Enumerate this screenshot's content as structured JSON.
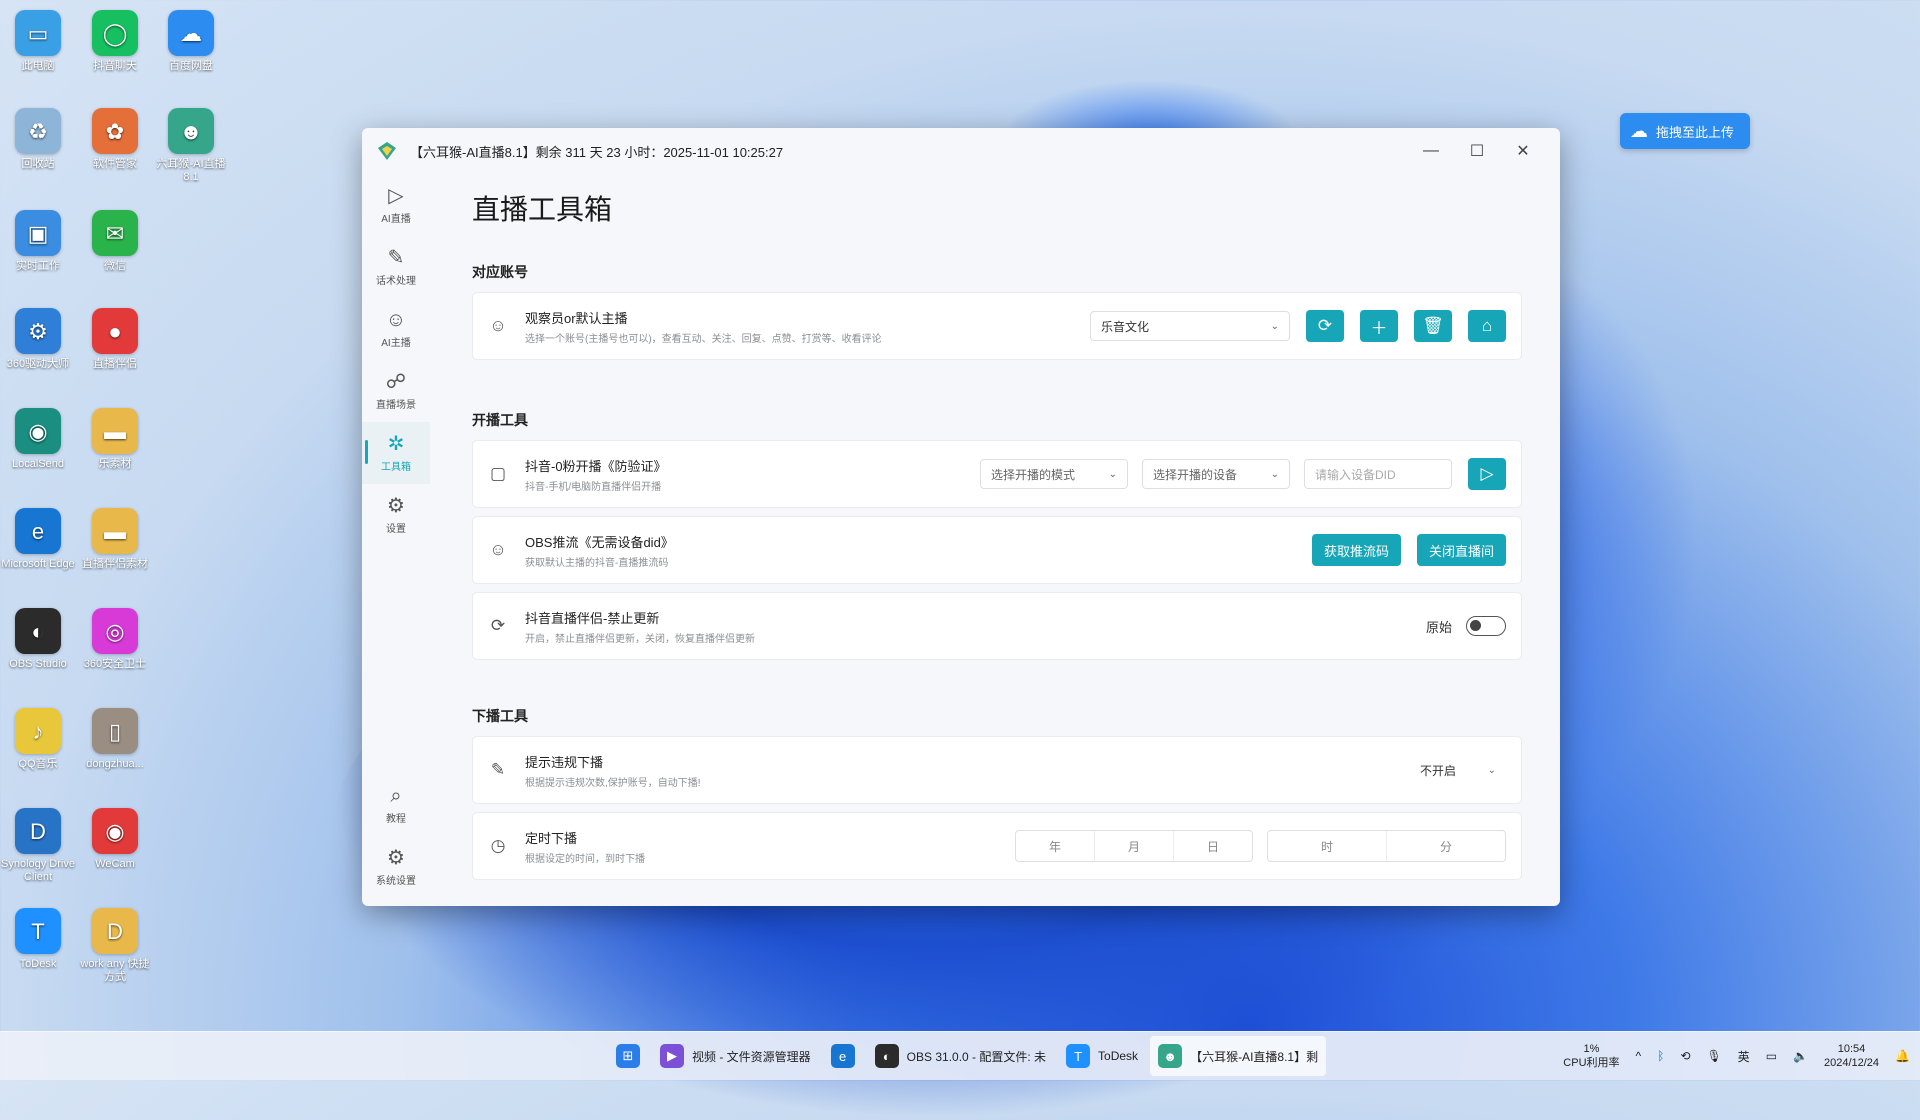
{
  "desktop": {
    "icons": [
      {
        "label": "此电脑",
        "color": "#3aa0e6",
        "glyph": "▭"
      },
      {
        "label": "抖音聊天",
        "color": "#16c060",
        "glyph": "◯"
      },
      {
        "label": "百度网盘",
        "color": "#2d8cf0",
        "glyph": "☁"
      },
      {
        "label": "回收站",
        "color": "#8db5d8",
        "glyph": "♻"
      },
      {
        "label": "软件管家",
        "color": "#e46f39",
        "glyph": "✿"
      },
      {
        "label": "六耳猴-AI直播8.1",
        "color": "#35a68a",
        "glyph": "☻"
      },
      {
        "label": "实时工作",
        "color": "#3a8de0",
        "glyph": "▣"
      },
      {
        "label": "微信",
        "color": "#29b34a",
        "glyph": "✉"
      },
      {
        "label": "360驱动大师",
        "color": "#2f7fd8",
        "glyph": "⚙"
      },
      {
        "label": "直播伴侣",
        "color": "#e23a3a",
        "glyph": "●"
      },
      {
        "label": "LocalSend",
        "color": "#1a8e80",
        "glyph": "◉"
      },
      {
        "label": "乐素材",
        "color": "#e8b94a",
        "glyph": "▬"
      },
      {
        "label": "Microsoft Edge",
        "color": "#1676d2",
        "glyph": "e"
      },
      {
        "label": "直播伴侣素材",
        "color": "#e8b94a",
        "glyph": "▬"
      },
      {
        "label": "OBS Studio",
        "color": "#2b2b2b",
        "glyph": "◐"
      },
      {
        "label": "360安全卫士",
        "color": "#d83ad8",
        "glyph": "◎"
      },
      {
        "label": "QQ音乐",
        "color": "#e8c83a",
        "glyph": "♪"
      },
      {
        "label": "dongzhua...",
        "color": "#9a8d82",
        "glyph": "▯"
      },
      {
        "label": "Synology Drive Client",
        "color": "#2774c6",
        "glyph": "D"
      },
      {
        "label": "WeCam",
        "color": "#e23a3a",
        "glyph": "◉"
      },
      {
        "label": "ToDesk",
        "color": "#1e90ff",
        "glyph": "T"
      },
      {
        "label": "work any 快捷方式",
        "color": "#e8b94a",
        "glyph": "D"
      }
    ]
  },
  "upload_chip": {
    "label": "拖拽至此上传"
  },
  "window": {
    "title": "【六耳猴-AI直播8.1】剩余 311 天 23 小时：2025-11-01 10:25:27",
    "controls": {
      "minimize": "—",
      "maximize": "☐",
      "close": "✕"
    }
  },
  "sidebar": {
    "items": [
      {
        "label": "AI直播",
        "icon": "▷"
      },
      {
        "label": "话术处理",
        "icon": "✎"
      },
      {
        "label": "AI主播",
        "icon": "☺"
      },
      {
        "label": "直播场景",
        "icon": "☍"
      },
      {
        "label": "工具箱",
        "icon": "✲"
      },
      {
        "label": "设置",
        "icon": "⚙"
      }
    ],
    "bottom": [
      {
        "label": "教程",
        "icon": "⌕"
      },
      {
        "label": "系统设置",
        "icon": "⚙"
      }
    ]
  },
  "main": {
    "title": "直播工具箱",
    "sections": {
      "account": "对应账号",
      "start": "开播工具",
      "stop": "下播工具"
    },
    "account_card": {
      "title": "观察员or默认主播",
      "desc": "选择一个账号(主播号也可以)，查看互动、关注、回复、点赞、打赏等、收看评论",
      "select_value": "乐音文化"
    },
    "douyin_card": {
      "title": "抖音-0粉开播《防验证》",
      "desc": "抖音-手机/电脑防直播伴侣开播",
      "mode_placeholder": "选择开播的模式",
      "device_placeholder": "选择开播的设备",
      "did_placeholder": "请输入设备DID"
    },
    "obs_card": {
      "title": "OBS推流《无需设备did》",
      "desc": "获取默认主播的抖音-直播推流码",
      "get_label": "获取推流码",
      "close_label": "关闭直播间"
    },
    "update_card": {
      "title": "抖音直播伴侣-禁止更新",
      "desc": "开启，禁止直播伴侣更新，关闭，恢复直播伴侣更新",
      "toggle_label": "原始",
      "toggle_on": false
    },
    "violation_card": {
      "title": "提示违规下播",
      "desc": "根据提示违规次数,保护账号，自动下播!",
      "select_value": "不开启"
    },
    "timer_card": {
      "title": "定时下播",
      "desc": "根据设定的时间，到时下播",
      "fields": [
        "年",
        "月",
        "日",
        "时",
        "分"
      ]
    }
  },
  "taskbar": {
    "apps": [
      {
        "label": "",
        "color": "#2b7de9",
        "glyph": "⊞"
      },
      {
        "label": "视频 - 文件资源管理器",
        "color": "#7b4fd6",
        "glyph": "▶"
      },
      {
        "label": "",
        "color": "#1676d2",
        "glyph": "e"
      },
      {
        "label": "OBS 31.0.0 - 配置文件: 未",
        "color": "#2b2b2b",
        "glyph": "◐"
      },
      {
        "label": "ToDesk",
        "color": "#1e90ff",
        "glyph": "T"
      },
      {
        "label": "【六耳猴-AI直播8.1】剩",
        "color": "#35a68a",
        "glyph": "☻"
      }
    ],
    "tray": {
      "cpu_value": "1%",
      "cpu_label": "CPU利用率",
      "caret": "^",
      "lang": "英",
      "time": "10:54",
      "date": "2024/12/24"
    }
  }
}
